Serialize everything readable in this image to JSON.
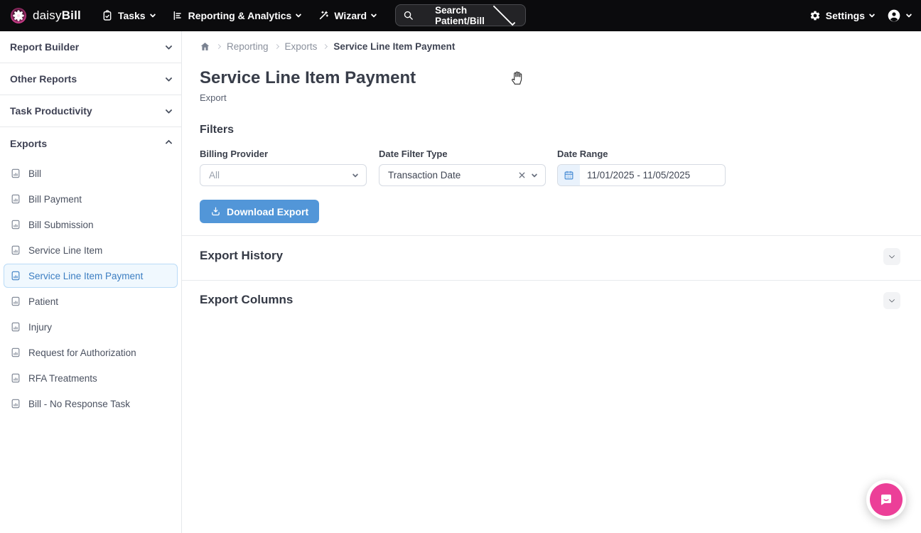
{
  "navbar": {
    "brand": {
      "daisy": "daisy",
      "bill": "Bill"
    },
    "items": [
      {
        "label": "Tasks"
      },
      {
        "label": "Reporting & Analytics"
      },
      {
        "label": "Wizard"
      }
    ],
    "search": {
      "label": "Search Patient/Bill"
    },
    "settings": {
      "label": "Settings"
    }
  },
  "sidebar": {
    "sections": [
      {
        "label": "Report Builder",
        "state": "collapsed"
      },
      {
        "label": "Other Reports",
        "state": "collapsed"
      },
      {
        "label": "Task Productivity",
        "state": "collapsed"
      },
      {
        "label": "Exports",
        "state": "expanded"
      }
    ],
    "items": [
      {
        "label": "Bill",
        "selected": false
      },
      {
        "label": "Bill Payment",
        "selected": false
      },
      {
        "label": "Bill Submission",
        "selected": false
      },
      {
        "label": "Service Line Item",
        "selected": false
      },
      {
        "label": "Service Line Item Payment",
        "selected": true
      },
      {
        "label": "Patient",
        "selected": false
      },
      {
        "label": "Injury",
        "selected": false
      },
      {
        "label": "Request for Authorization",
        "selected": false
      },
      {
        "label": "RFA Treatments",
        "selected": false
      },
      {
        "label": "Bill - No Response Task",
        "selected": false
      }
    ]
  },
  "breadcrumb": {
    "links": [
      {
        "label": "Reporting"
      },
      {
        "label": "Exports"
      },
      {
        "label": "Service Line Item Payment"
      }
    ]
  },
  "page": {
    "title": "Service Line Item Payment",
    "subtitle": "Export"
  },
  "filters": {
    "heading": "Filters",
    "billing_provider": {
      "label": "Billing Provider",
      "value": "All"
    },
    "date_filter_type": {
      "label": "Date Filter Type",
      "value": "Transaction Date"
    },
    "date_range": {
      "label": "Date Range",
      "value": "11/01/2025 - 11/05/2025"
    },
    "download_label": "Download Export"
  },
  "panels": [
    {
      "title": "Export History",
      "state": "collapsed"
    },
    {
      "title": "Export Columns",
      "state": "collapsed"
    }
  ],
  "icons": {
    "brand": "daisy-flower",
    "nav": [
      "clipboard-check",
      "bar-chart",
      "magic-wand"
    ],
    "search": "magnifier",
    "settings": "gear",
    "account": "person-circle",
    "breadcrumb_home": "house",
    "sidebar_item": "file-chart",
    "date_range": "calendar",
    "download": "download-tray",
    "clear": "x-mark",
    "chat": "speech-bubble-smile",
    "pointer": "hand-cursor"
  },
  "colors": {
    "navbar_bg": "#0b0b0d",
    "accent_blue": "#5296d8",
    "selected_bg": "#f0f8fe",
    "selected_border": "#badbf7",
    "selected_text": "#3c7ec2",
    "brand_pink": "#ec3f98",
    "calendar_icon_bg": "#e9f2fc",
    "divider": "#e8eaed"
  }
}
